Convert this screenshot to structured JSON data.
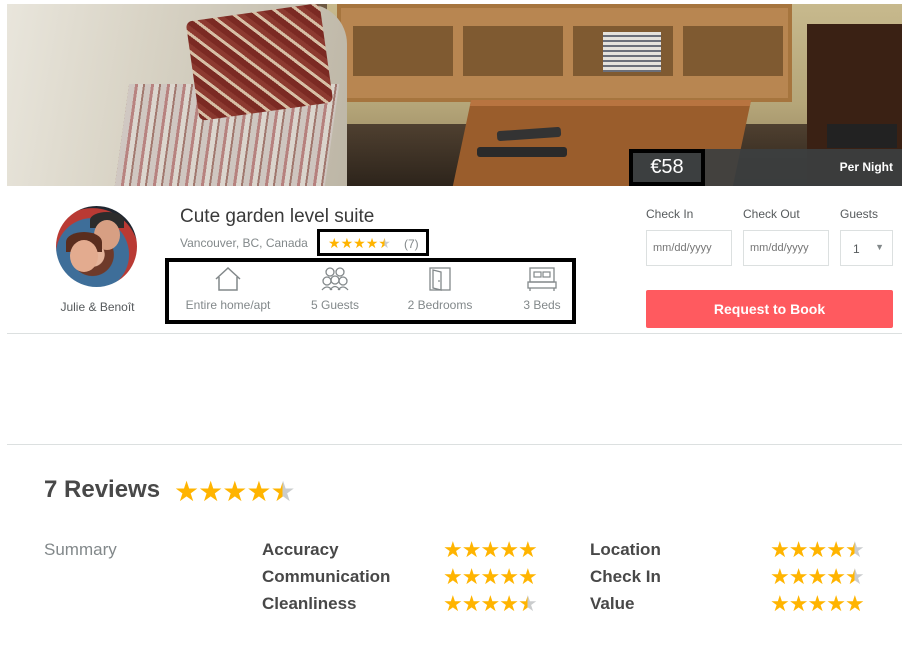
{
  "hero": {
    "price": "€58",
    "per_night": "Per Night"
  },
  "host": {
    "name": "Julie & Benoît"
  },
  "listing": {
    "title": "Cute garden level suite",
    "location": "Vancouver, BC, Canada",
    "rating": 4.5,
    "review_count": "(7)",
    "features": [
      {
        "icon": "house-icon",
        "label": "Entire home/apt"
      },
      {
        "icon": "guests-icon",
        "label": "5 Guests"
      },
      {
        "icon": "door-icon",
        "label": "2 Bedrooms"
      },
      {
        "icon": "bed-icon",
        "label": "3 Beds"
      }
    ]
  },
  "booking": {
    "check_in_label": "Check In",
    "check_out_label": "Check Out",
    "guests_label": "Guests",
    "date_placeholder": "mm/dd/yyyy",
    "guests_value": "1",
    "request_button": "Request to Book"
  },
  "reviews": {
    "title": "7 Reviews",
    "overall_rating": 4.5,
    "summary_label": "Summary",
    "categories": [
      {
        "label": "Accuracy",
        "rating": 5
      },
      {
        "label": "Communication",
        "rating": 5
      },
      {
        "label": "Cleanliness",
        "rating": 4.5
      },
      {
        "label": "Location",
        "rating": 4.5
      },
      {
        "label": "Check In",
        "rating": 4.5
      },
      {
        "label": "Value",
        "rating": 5
      }
    ]
  },
  "colors": {
    "accent": "#ff5a5f",
    "star": "#ffb400",
    "star_empty": "#cacccd"
  }
}
